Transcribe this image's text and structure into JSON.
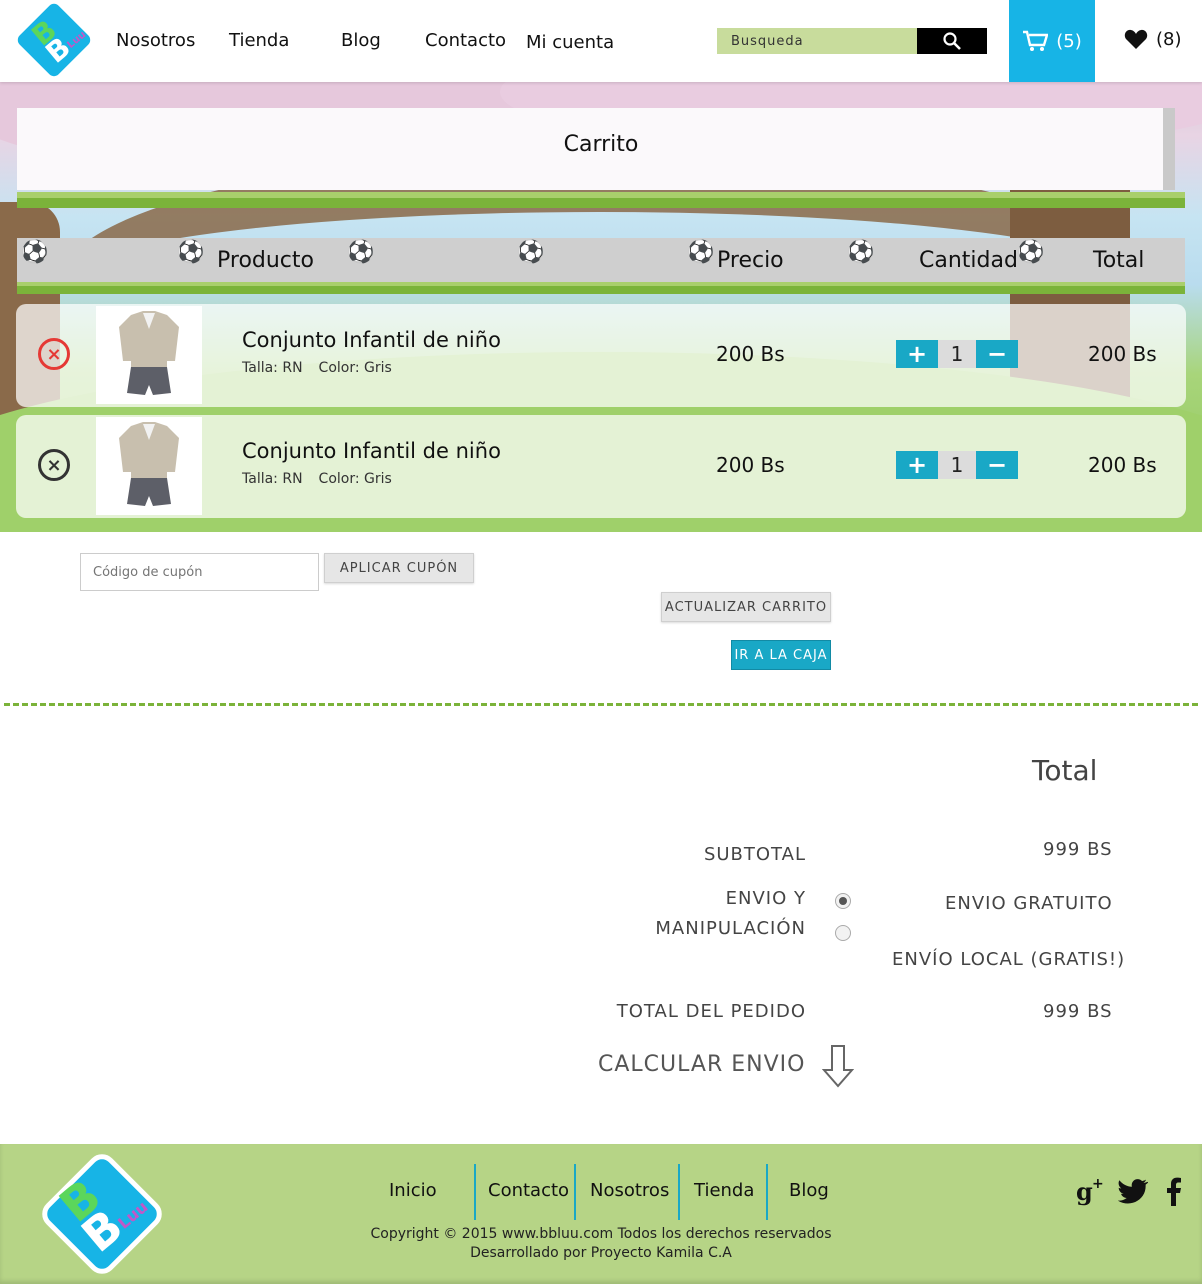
{
  "header": {
    "logo_text": "BBLuu",
    "nav": [
      "Nosotros",
      "Tienda",
      "Blog",
      "Contacto",
      "Mi cuenta"
    ],
    "search_placeholder": "Busqueda",
    "cart_count": "(5)",
    "wishlist_count": "(8)"
  },
  "cart": {
    "title": "Carrito",
    "columns": {
      "product": "Producto",
      "price": "Precio",
      "quantity": "Cantidad",
      "total": "Total"
    },
    "items": [
      {
        "name": "Conjunto Infantil de niño",
        "size": "Talla: RN",
        "color": "Color: Gris",
        "price": "200 Bs",
        "qty": "1",
        "total": "200 Bs",
        "remove_color": "#e53935"
      },
      {
        "name": "Conjunto Infantil de niño",
        "size": "Talla: RN",
        "color": "Color: Gris",
        "price": "200 Bs",
        "qty": "1",
        "total": "200 Bs",
        "remove_color": "#333333"
      }
    ]
  },
  "actions": {
    "coupon_placeholder": "Código de cupón",
    "apply_coupon": "APLICAR CUPÓN",
    "update_cart": "ACTUALIZAR CARRITO",
    "checkout": "IR A LA CAJA"
  },
  "totals": {
    "title": "Total",
    "subtotal_label": "SUBTOTAL",
    "subtotal_value": "999 BS",
    "shipping_label_1": "ENVIO Y",
    "shipping_label_2": "MANIPULACIÓN",
    "shipping_option_1": "ENVIO GRATUITO",
    "shipping_option_2": "ENVÍO LOCAL (GRATIS!)",
    "order_total_label": "TOTAL DEL PEDIDO",
    "order_total_value": "999 BS",
    "calculate": "CALCULAR ENVIO"
  },
  "footer": {
    "links": [
      "Inicio",
      "Contacto",
      "Nosotros",
      "Tienda",
      "Blog"
    ],
    "copyright": "Copyright © 2015 www.bbluu.com Todos los derechos reservados",
    "developer": "Desarrollado por Proyecto Kamila C.A"
  },
  "colors": {
    "accent": "#17b4e6",
    "green": "#7bb33a",
    "footer": "#b6d486",
    "search": "#c8dc9c"
  }
}
